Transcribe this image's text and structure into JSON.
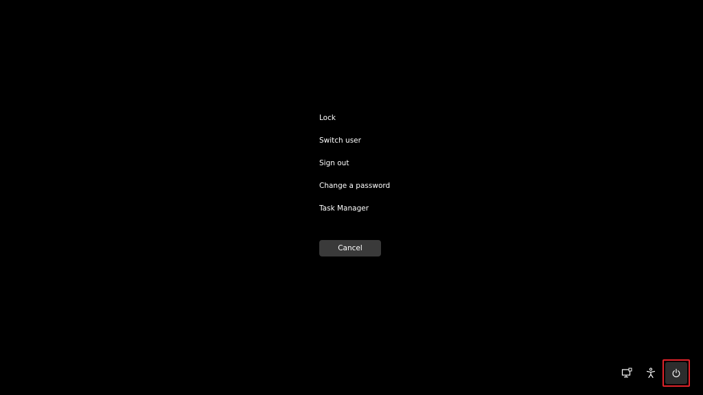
{
  "menu": {
    "items": [
      {
        "id": "lock",
        "label": "Lock"
      },
      {
        "id": "switch-user",
        "label": "Switch user"
      },
      {
        "id": "sign-out",
        "label": "Sign out"
      },
      {
        "id": "change-password",
        "label": "Change a password"
      },
      {
        "id": "task-manager",
        "label": "Task Manager"
      }
    ]
  },
  "cancel": {
    "label": "Cancel"
  },
  "corner": {
    "network_icon": "network-icon",
    "accessibility_icon": "accessibility-icon",
    "power_icon": "power-icon",
    "highlight_color": "#e3242b"
  },
  "colors": {
    "background": "#000000",
    "text": "#ffffff",
    "button": "#3a3a3a"
  }
}
